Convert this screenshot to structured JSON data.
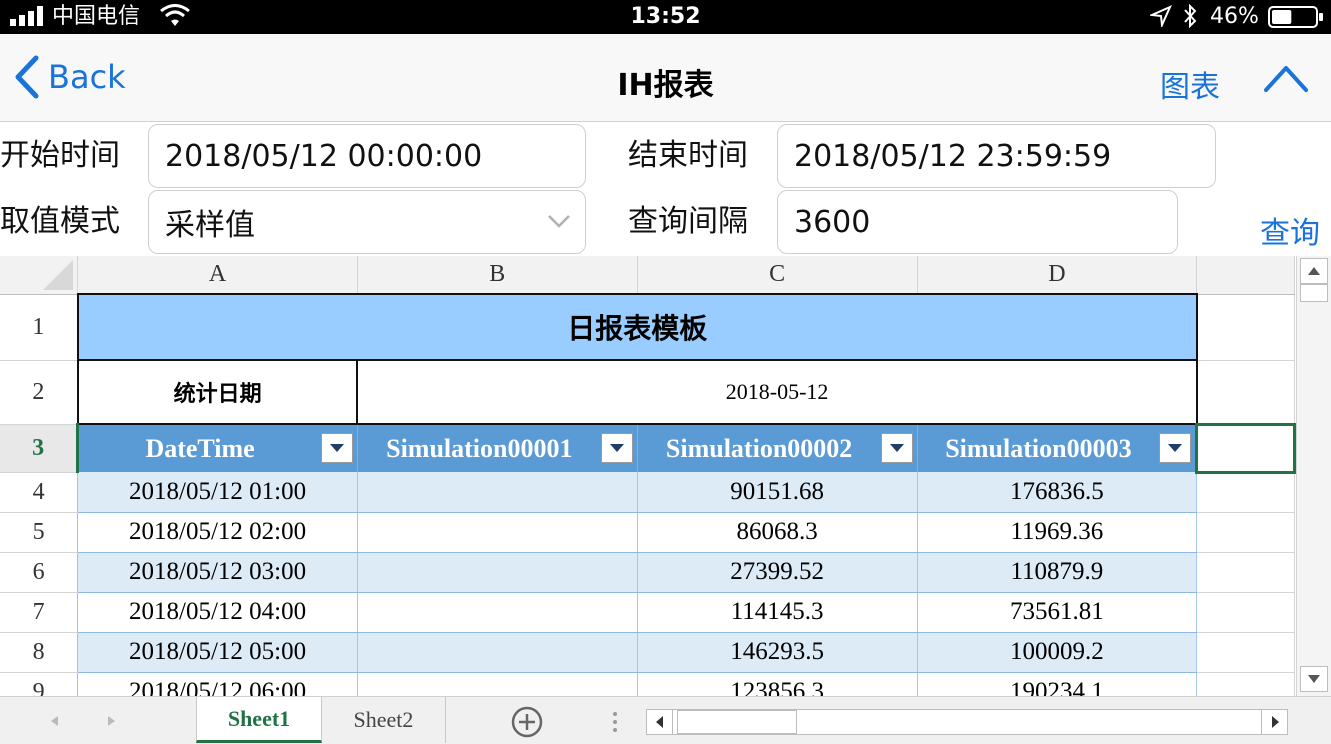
{
  "status_bar": {
    "carrier": "中国电信",
    "time": "13:52",
    "battery": "46%",
    "battery_level": 0.46
  },
  "nav": {
    "back_label": "Back",
    "title": "IH报表",
    "chart_label": "图表"
  },
  "filters": {
    "start_label": "开始时间",
    "start_value": "2018/05/12 00:00:00",
    "end_label": "结束时间",
    "end_value": "2018/05/12 23:59:59",
    "mode_label": "取值模式",
    "mode_value": "采样值",
    "interval_label": "查询间隔",
    "interval_value": "3600",
    "query_label": "查询"
  },
  "sheet": {
    "columns": [
      "A",
      "B",
      "C",
      "D"
    ],
    "title": "日报表模板",
    "stat_label": "统计日期",
    "stat_value": "2018-05-12",
    "row_numbers": [
      "1",
      "2",
      "3",
      "4",
      "5",
      "6",
      "7",
      "8",
      "9"
    ],
    "headers": [
      "DateTime",
      "Simulation00001",
      "Simulation00002",
      "Simulation00003"
    ],
    "rows": [
      [
        "2018/05/12 01:00",
        "",
        "90151.68",
        "176836.5"
      ],
      [
        "2018/05/12 02:00",
        "",
        "86068.3",
        "11969.36"
      ],
      [
        "2018/05/12 03:00",
        "",
        "27399.52",
        "110879.9"
      ],
      [
        "2018/05/12 04:00",
        "",
        "114145.3",
        "73561.81"
      ],
      [
        "2018/05/12 05:00",
        "",
        "146293.5",
        "100009.2"
      ],
      [
        "2018/05/12 06:00",
        "",
        "123856.3",
        "190234.1"
      ]
    ]
  },
  "tabs": {
    "sheet1": "Sheet1",
    "sheet2": "Sheet2"
  },
  "colors": {
    "accent": "#1a73d9",
    "title_fill": "#99ccff",
    "header_fill": "#5b9bd5",
    "band_fill": "#ddebf7",
    "excel_green": "#217346"
  }
}
